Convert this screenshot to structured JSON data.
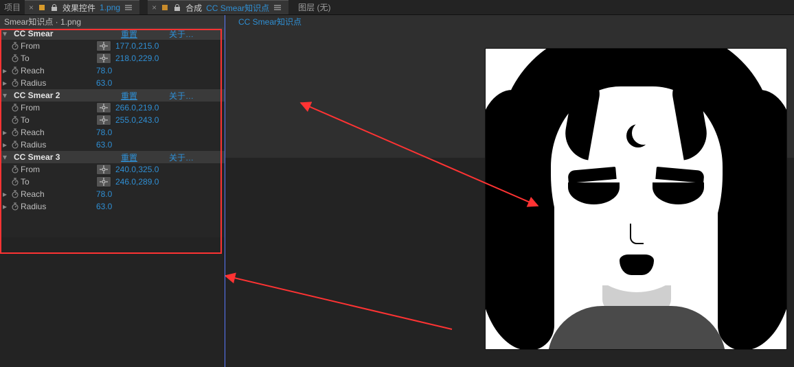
{
  "top_tabs_left": {
    "pre_label": "项目",
    "active": {
      "prefix": "效果控件",
      "filename": "1.png"
    }
  },
  "top_tabs_right": {
    "active": {
      "prefix": "合成",
      "comp_name": "CC Smear知识点"
    },
    "layer_label": "图层 (无)"
  },
  "left_panel": {
    "crumb": "Smear知识点 · 1.png",
    "effects": [
      {
        "name": "CC Smear",
        "reset": "重置",
        "about": "关于…",
        "params": [
          {
            "label": "From",
            "type": "point",
            "value": "177.0,215.0"
          },
          {
            "label": "To",
            "type": "point",
            "value": "218.0,229.0"
          },
          {
            "label": "Reach",
            "type": "scalar",
            "value": "78.0"
          },
          {
            "label": "Radius",
            "type": "scalar",
            "value": "63.0"
          }
        ]
      },
      {
        "name": "CC Smear 2",
        "reset": "重置",
        "about": "关于…",
        "params": [
          {
            "label": "From",
            "type": "point",
            "value": "266.0,219.0"
          },
          {
            "label": "To",
            "type": "point",
            "value": "255.0,243.0"
          },
          {
            "label": "Reach",
            "type": "scalar",
            "value": "78.0"
          },
          {
            "label": "Radius",
            "type": "scalar",
            "value": "63.0"
          }
        ]
      },
      {
        "name": "CC Smear 3",
        "reset": "重置",
        "about": "关于…",
        "params": [
          {
            "label": "From",
            "type": "point",
            "value": "240.0,325.0"
          },
          {
            "label": "To",
            "type": "point",
            "value": "246.0,289.0"
          },
          {
            "label": "Reach",
            "type": "scalar",
            "value": "78.0"
          },
          {
            "label": "Radius",
            "type": "scalar",
            "value": "63.0"
          }
        ]
      }
    ]
  },
  "right_panel": {
    "crumb": "CC Smear知识点"
  },
  "icons": {
    "close": "×",
    "menu": "≡",
    "lock": "lock-icon",
    "square": "square-icon"
  },
  "colors": {
    "link": "#2f8fd4",
    "annotation": "#ff3333"
  }
}
